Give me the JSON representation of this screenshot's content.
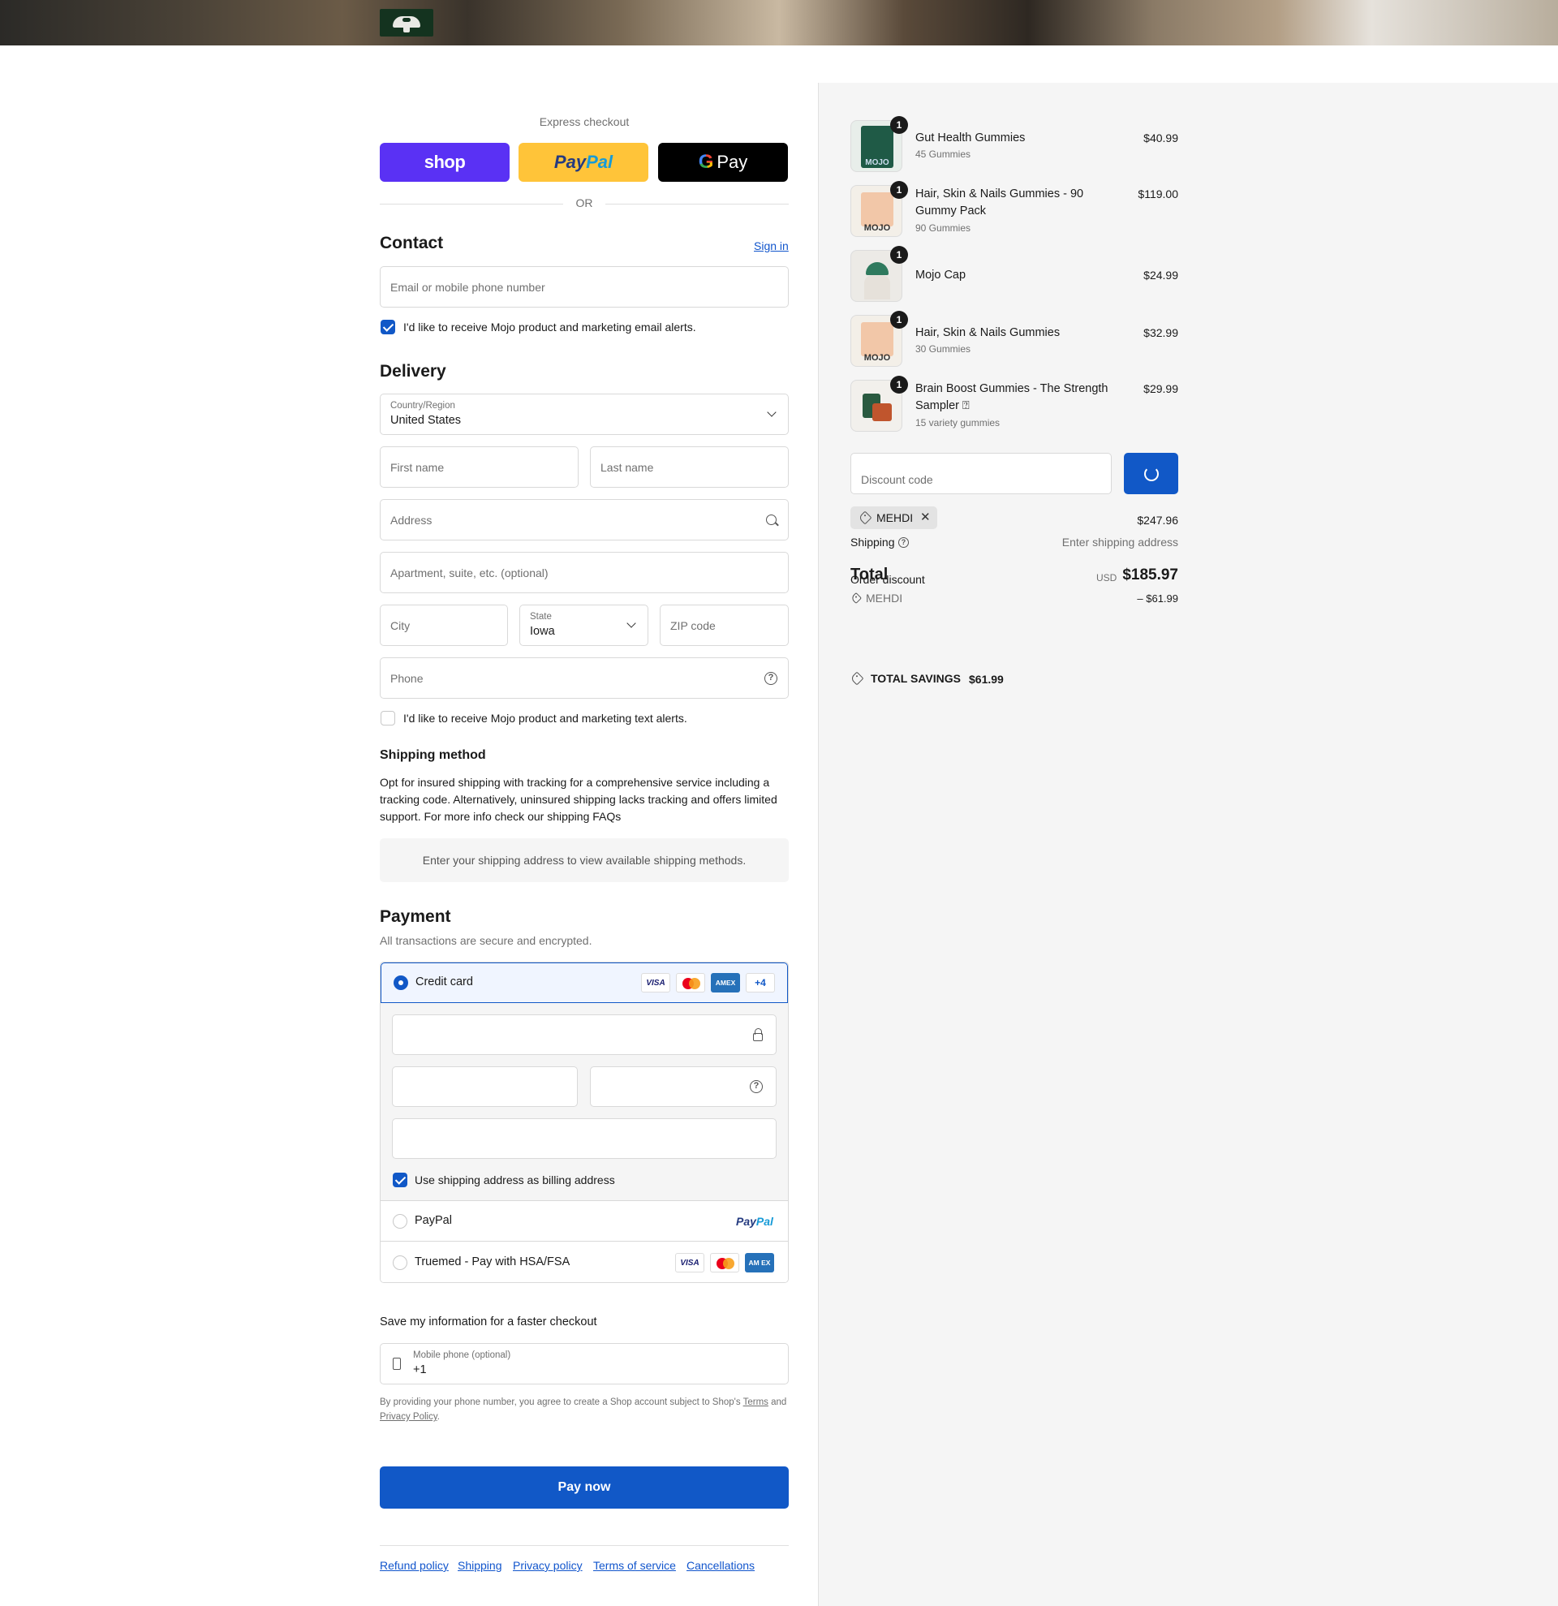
{
  "express": {
    "title": "Express checkout",
    "shop_label": "shop",
    "paypal_part1": "Pay",
    "paypal_part2": "Pal",
    "gpay_g": "G",
    "gpay_label": "Pay",
    "or_label": "OR"
  },
  "contact": {
    "title": "Contact",
    "sign_in": "Sign in",
    "email_placeholder": "Email or mobile phone number",
    "email_alerts_label": "I'd like to receive Mojo product and marketing email alerts.",
    "email_alerts_checked": true
  },
  "delivery": {
    "title": "Delivery",
    "country_label": "Country/Region",
    "country_value": "United States",
    "first_name_placeholder": "First name",
    "last_name_placeholder": "Last name",
    "address_placeholder": "Address",
    "apartment_placeholder": "Apartment, suite, etc. (optional)",
    "city_placeholder": "City",
    "state_label": "State",
    "state_value": "Iowa",
    "zip_placeholder": "ZIP code",
    "phone_placeholder": "Phone",
    "text_alerts_label": "I'd like to receive Mojo product and marketing text alerts.",
    "text_alerts_checked": false
  },
  "shipping_method": {
    "title": "Shipping method",
    "description": "Opt for insured shipping with tracking for a comprehensive service including a tracking code. Alternatively, uninsured shipping lacks tracking and offers limited support. For more info check our shipping FAQs",
    "notice": "Enter your shipping address to view available shipping methods."
  },
  "payment": {
    "title": "Payment",
    "subtitle": "All transactions are secure and encrypted.",
    "credit_card_label": "Credit card",
    "card_visa": "VISA",
    "card_amex": "AMEX",
    "card_more": "+4",
    "billing_same_label": "Use shipping address as billing address",
    "paypal_label": "PayPal",
    "paypal_logo_1": "Pay",
    "paypal_logo_2": "Pal",
    "truemed_label": "Truemed - Pay with HSA/FSA",
    "truemed_amex": "AM EX"
  },
  "save_info": {
    "title": "Save my information for a faster checkout",
    "phone_label": "Mobile phone (optional)",
    "phone_value": "+1",
    "legal_prefix": "By providing your phone number, you agree to create a Shop account subject to Shop's",
    "legal_terms": "Terms",
    "legal_and": "and",
    "legal_privacy": "Privacy Policy",
    "legal_suffix": "."
  },
  "pay_now_label": "Pay now",
  "footer_links": [
    "Refund policy",
    "Shipping",
    "Privacy policy",
    "Terms of service",
    "Cancellations"
  ],
  "summary": {
    "items": [
      {
        "name": "Gut Health Gummies",
        "variant": "45 Gummies",
        "price": "$40.99",
        "qty": "1"
      },
      {
        "name": "Hair, Skin & Nails Gummies - 90 Gummy Pack",
        "variant": "90 Gummies",
        "price": "$119.00",
        "qty": "1"
      },
      {
        "name": "Mojo Cap",
        "variant": "",
        "price": "$24.99",
        "qty": "1"
      },
      {
        "name": "Hair, Skin & Nails Gummies",
        "variant": "30 Gummies",
        "price": "$32.99",
        "qty": "1"
      },
      {
        "name": "Brain Boost Gummies - The Strength Sampler ⍰",
        "variant": "15 variety gummies",
        "price": "$29.99",
        "qty": "1"
      }
    ],
    "thumb_brand": "MOJO",
    "discount_placeholder": "Discount code",
    "applied_code": "MEHDI",
    "subtotal_value": "$247.96",
    "shipping_label": "Shipping",
    "shipping_value": "Enter shipping address",
    "order_discount_label": "Order discount",
    "total_label": "Total",
    "currency": "USD",
    "total_value": "$185.97",
    "discount_code_line": "MEHDI",
    "discount_amount": "– $61.99",
    "savings_label": "TOTAL SAVINGS",
    "savings_value": "$61.99"
  },
  "colors": {
    "accent": "#1158c7",
    "shop_purple": "#5a31f4",
    "paypal_yellow": "#ffc439"
  }
}
